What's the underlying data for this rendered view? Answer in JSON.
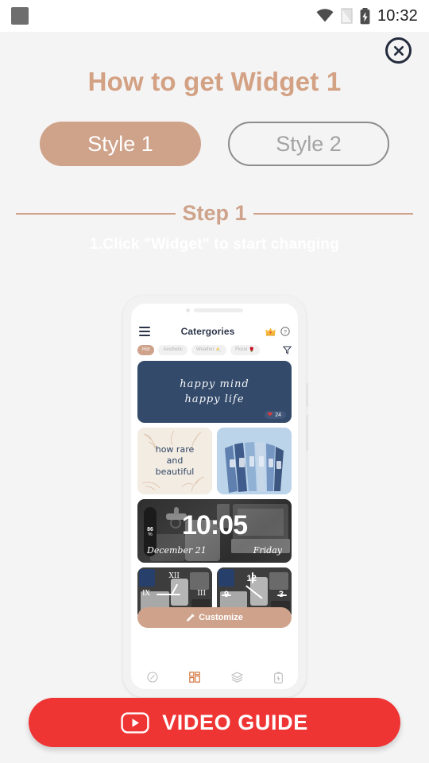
{
  "status_bar": {
    "time": "10:32",
    "icons": [
      "square-icon",
      "wifi-icon",
      "sim-card-icon",
      "battery-charging-icon"
    ]
  },
  "dialog": {
    "close_icon": "close-circle-icon",
    "title": "How to get Widget 1",
    "style_tabs": [
      {
        "label": "Style 1",
        "active": true
      },
      {
        "label": "Style 2",
        "active": false
      }
    ],
    "step": {
      "label": "Step 1",
      "instruction": "1.Click \"Widget\" to start changing"
    }
  },
  "phone_preview": {
    "app_header": {
      "menu_icon": "hamburger-menu-icon",
      "title": "Catergories",
      "crown_icon": "crown-icon",
      "help_icon": "help-circle-icon"
    },
    "chips": [
      {
        "label": "Hot",
        "emoji": "",
        "active": true
      },
      {
        "label": "Aesthetic",
        "emoji": "",
        "active": false
      },
      {
        "label": "Weather",
        "emoji": "⛅",
        "active": false
      },
      {
        "label": "Floral",
        "emoji": "🌹",
        "active": false
      }
    ],
    "filter_icon": "filter-icon",
    "cards": {
      "quote": {
        "line1": "happy mind",
        "line2": "happy life",
        "like_count": "24",
        "heart_icon": "heart-icon"
      },
      "rare": {
        "line1": "how rare",
        "line2": "and",
        "line3": "beautiful"
      },
      "books": {
        "alt": "blue books photo"
      },
      "clock": {
        "time": "10:05",
        "date": "December 21",
        "day": "Friday",
        "battery_value": "86",
        "battery_unit": "%"
      },
      "analog_roman": {
        "n12": "XII",
        "n9": "IX",
        "n3": "III"
      },
      "analog_arabic": {
        "n12": "12",
        "n9": "9",
        "n3": "3"
      }
    },
    "customize_button": {
      "label": "Customize",
      "icon": "pencil-icon"
    },
    "bottom_nav": [
      {
        "name": "discover",
        "icon": "compass-icon",
        "active": false
      },
      {
        "name": "widget",
        "icon": "widget-grid-icon",
        "active": true
      },
      {
        "name": "themes",
        "icon": "layers-icon",
        "active": false
      },
      {
        "name": "battery",
        "icon": "battery-icon",
        "active": false
      }
    ]
  },
  "video_guide": {
    "label": "VIDEO GUIDE",
    "icon": "youtube-play-icon"
  },
  "colors": {
    "accent_tan": "#cfa38b",
    "title_tan": "#d3a183",
    "navy": "#334a6b",
    "red": "#ef3434",
    "page_bg": "#f4f4f4"
  }
}
